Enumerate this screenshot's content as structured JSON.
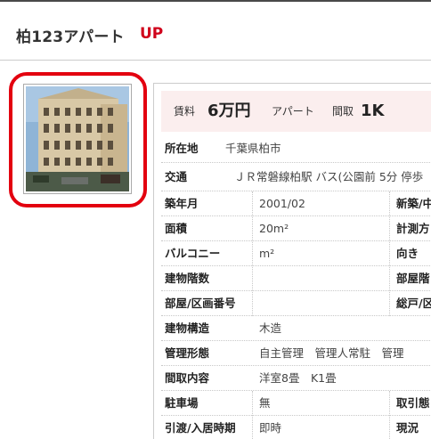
{
  "header": {
    "title": "柏123アパート",
    "badge": "UP"
  },
  "price": {
    "rent_label": "賃料",
    "rent_value": "6万円",
    "type": "アパート",
    "layout_label": "間取",
    "layout_value": "1K"
  },
  "location": {
    "label": "所在地",
    "value": "千葉県柏市"
  },
  "transport": {
    "label": "交通",
    "value": "ＪＲ常磐線柏駅 バス(公園前 5分 停歩"
  },
  "rows": [
    {
      "label": "築年月",
      "value": "2001/02",
      "label2": "新築/中"
    },
    {
      "label": "面積",
      "value": "20m²",
      "label2": "計測方"
    },
    {
      "label": "バルコニー",
      "value": "m²",
      "label2": "向き"
    },
    {
      "label": "建物階数",
      "value": "",
      "label2": "部屋階"
    },
    {
      "label": "部屋/区画番号",
      "value": "",
      "label2": "総戸/区"
    },
    {
      "label": "建物構造",
      "value": "木造",
      "label2": ""
    },
    {
      "label": "管理形態",
      "value": "自主管理　管理人常駐　管理",
      "label2": ""
    },
    {
      "label": "間取内容",
      "value": "洋室8畳　K1畳",
      "label2": ""
    },
    {
      "label": "駐車場",
      "value": "無",
      "label2": "取引態"
    },
    {
      "label": "引渡/入居時期",
      "value": "即時",
      "label2": "現況"
    }
  ]
}
